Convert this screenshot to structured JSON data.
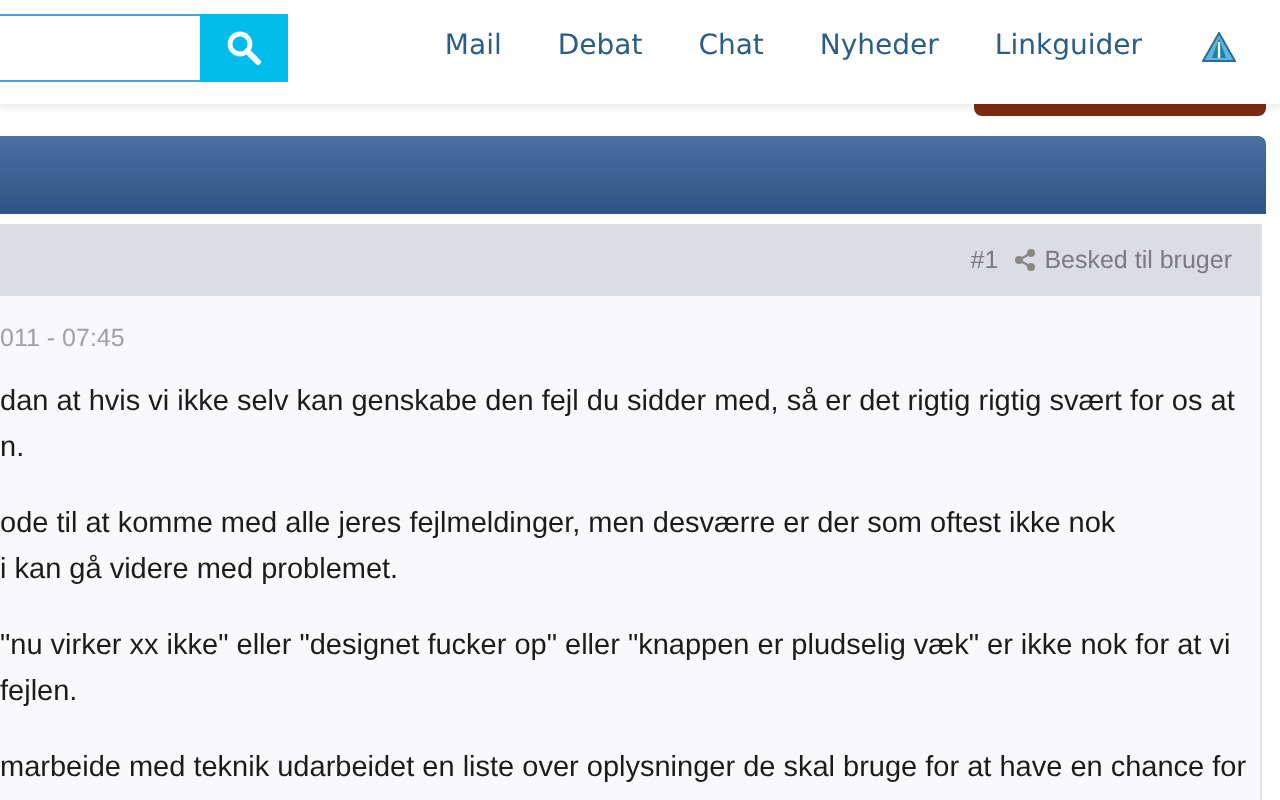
{
  "nav": {
    "items": [
      "Mail",
      "Debat",
      "Chat",
      "Nyheder",
      "Linkguider"
    ]
  },
  "post": {
    "number": "#1",
    "message_link": "Besked til bruger",
    "date": "011 - 07:45",
    "paragraphs": [
      [
        "dan at hvis vi ikke selv kan genskabe den fejl du sidder med, så er det rigtig rigtig svært for os at",
        "n."
      ],
      [
        "ode til at komme med alle jeres fejlmeldinger, men desværre er der som oftest ikke nok",
        "i kan gå videre med problemet."
      ],
      [
        "\"nu virker xx ikke\" eller \"designet fucker op\" eller \"knappen er pludselig væk\" er ikke nok for at vi",
        "fejlen."
      ],
      [
        "marbeide med teknik udarbeidet en liste over oplysninger de skal bruge for at have en chance for"
      ]
    ]
  }
}
